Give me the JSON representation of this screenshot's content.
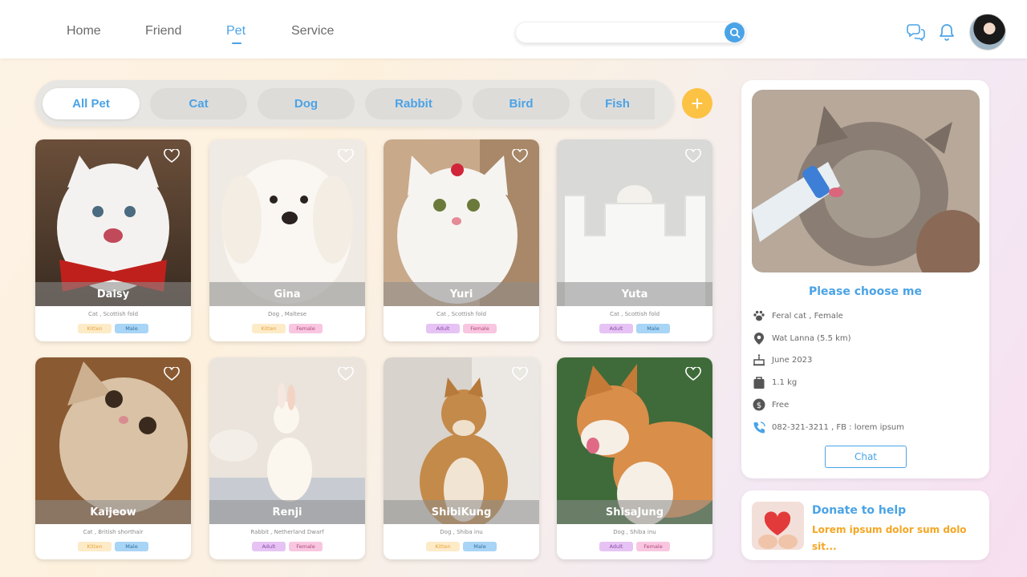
{
  "nav": {
    "items": [
      {
        "label": "Home"
      },
      {
        "label": "Friend"
      },
      {
        "label": "Pet",
        "active": true
      },
      {
        "label": "Service"
      }
    ]
  },
  "search": {
    "placeholder": "",
    "value": ""
  },
  "header_icons": [
    "chat-bubbles-icon",
    "bell-icon"
  ],
  "filters": {
    "items": [
      "All Pet",
      "Cat",
      "Dog",
      "Rabbit",
      "Bird",
      "Fish"
    ],
    "active": "All Pet",
    "add_label": "+"
  },
  "pets": [
    {
      "name": "Daisy",
      "breed": "Cat , Scottish fold",
      "tags": [
        "Kitten",
        "Male"
      ]
    },
    {
      "name": "Gina",
      "breed": "Dog , Maltese",
      "tags": [
        "Kitten",
        "Female"
      ]
    },
    {
      "name": "Yuri",
      "breed": "Cat , Scottish fold",
      "tags": [
        "Adult",
        "Female"
      ]
    },
    {
      "name": "Yuta",
      "breed": "Cat , Scottish fold",
      "tags": [
        "Adult",
        "Male"
      ]
    },
    {
      "name": "Kaijeow",
      "breed": "Cat , British shorthair",
      "tags": [
        "Kitten",
        "Male"
      ]
    },
    {
      "name": "Renji",
      "breed": "Rabbit , Netherland Dwarf",
      "tags": [
        "Adult",
        "Female"
      ]
    },
    {
      "name": "ShibiKung",
      "breed": "Dog , Shiba inu",
      "tags": [
        "Kitten",
        "Male"
      ]
    },
    {
      "name": "ShisaJung",
      "breed": "Dog , Shiba inu",
      "tags": [
        "Adult",
        "Female"
      ]
    }
  ],
  "tag_colors": {
    "Kitten": {
      "bg": "#fdebc8",
      "fg": "#e8a23b"
    },
    "Adult": {
      "bg": "#e6c3f4",
      "fg": "#8a4aa8"
    },
    "Male": {
      "bg": "#a8d4f5",
      "fg": "#2f6fa0"
    },
    "Female": {
      "bg": "#f8c6e0",
      "fg": "#b0487a"
    }
  },
  "detail": {
    "title": "Please choose me",
    "type": "Feral cat , Female",
    "location": "Wat Lanna (5.5 km)",
    "birth": "June 2023",
    "weight": "1.1 kg",
    "price": "Free",
    "contact": "082-321-3211 , FB : lorem ipsum",
    "chat_label": "Chat"
  },
  "donate": {
    "title": "Donate to help",
    "text": "Lorem ipsum dolor sum dolo sit..."
  },
  "colors": {
    "accent": "#4aa3e6",
    "add_button": "#fcc244",
    "donate_text": "#f5a623"
  }
}
